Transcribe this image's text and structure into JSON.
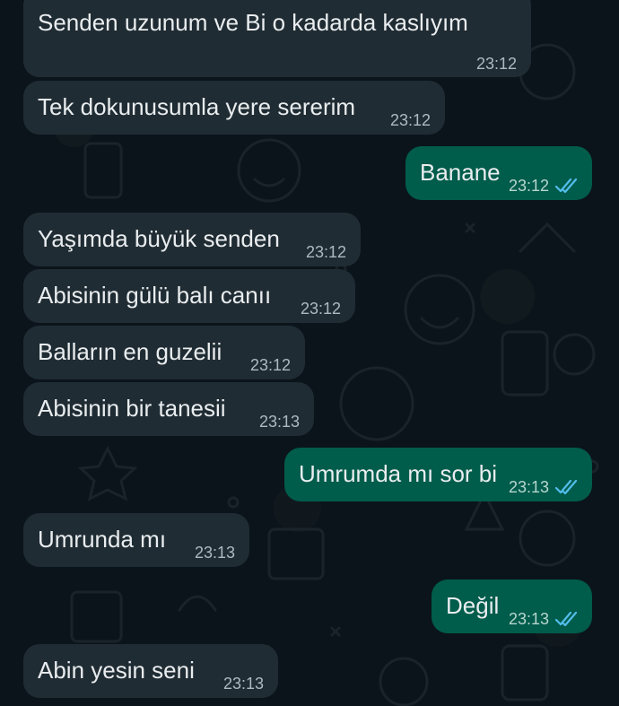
{
  "messages": [
    {
      "direction": "incoming",
      "text": "Senden uzunum ve Bi o kadarda kaslıyım",
      "time": "23:12"
    },
    {
      "direction": "incoming",
      "text": "Tek dokunusumla yere sererim",
      "time": "23:12"
    },
    {
      "direction": "outgoing",
      "text": "Banane",
      "time": "23:12",
      "status": "read-double-check-icon"
    },
    {
      "direction": "incoming",
      "text": "Yaşımda büyük senden",
      "time": "23:12"
    },
    {
      "direction": "incoming",
      "text": "Abisinin gülü balı canıı",
      "time": "23:12"
    },
    {
      "direction": "incoming",
      "text": "Balların en guzelii",
      "time": "23:12"
    },
    {
      "direction": "incoming",
      "text": "Abisinin bir tanesii",
      "time": "23:13"
    },
    {
      "direction": "outgoing",
      "text": "Umrumda mı sor bi",
      "time": "23:13",
      "status": "read-double-check-icon"
    },
    {
      "direction": "incoming",
      "text": "Umrunda mı",
      "time": "23:13"
    },
    {
      "direction": "outgoing",
      "text": "Değil",
      "time": "23:13",
      "status": "read-double-check-icon"
    },
    {
      "direction": "incoming",
      "text": "Abin yesin seni",
      "time": "23:13"
    }
  ],
  "colors": {
    "background": "#0b141a",
    "incoming_bubble": "#202c33",
    "outgoing_bubble": "#005c4b",
    "read_tick": "#53bdeb",
    "text": "#e9edef",
    "timestamp": "#aebac1"
  }
}
